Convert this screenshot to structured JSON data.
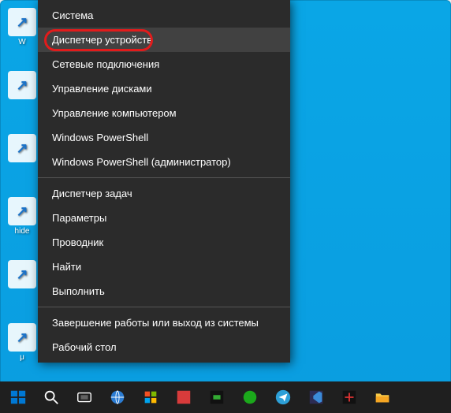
{
  "desktop": {
    "icons": [
      {
        "label": "W"
      },
      {
        "label": ""
      },
      {
        "label": ""
      },
      {
        "label": "hide"
      },
      {
        "label": ""
      },
      {
        "label": "μ"
      }
    ]
  },
  "menu": {
    "groups": [
      [
        {
          "label": "Система",
          "highlight": false,
          "ring": false
        },
        {
          "label": "Диспетчер устройств",
          "highlight": true,
          "ring": true
        },
        {
          "label": "Сетевые подключения",
          "highlight": false
        },
        {
          "label": "Управление дисками",
          "highlight": false
        },
        {
          "label": "Управление компьютером",
          "highlight": false
        },
        {
          "label": "Windows PowerShell",
          "highlight": false
        },
        {
          "label": "Windows PowerShell (администратор)",
          "highlight": false
        }
      ],
      [
        {
          "label": "Диспетчер задач",
          "highlight": false
        },
        {
          "label": "Параметры",
          "highlight": false
        },
        {
          "label": "Проводник",
          "highlight": false
        },
        {
          "label": "Найти",
          "highlight": false
        },
        {
          "label": "Выполнить",
          "highlight": false
        }
      ],
      [
        {
          "label": "Завершение работы или выход из системы",
          "highlight": false
        },
        {
          "label": "Рабочий стол",
          "highlight": false
        }
      ]
    ]
  },
  "taskbar": {
    "items": [
      {
        "name": "start-button"
      },
      {
        "name": "search-button"
      },
      {
        "name": "taskview-button"
      },
      {
        "name": "app-edge"
      },
      {
        "name": "app-store"
      },
      {
        "name": "app-red"
      },
      {
        "name": "app-green"
      },
      {
        "name": "app-media"
      },
      {
        "name": "app-telegram"
      },
      {
        "name": "app-vscode"
      },
      {
        "name": "app-tool"
      },
      {
        "name": "app-explorer"
      }
    ]
  }
}
